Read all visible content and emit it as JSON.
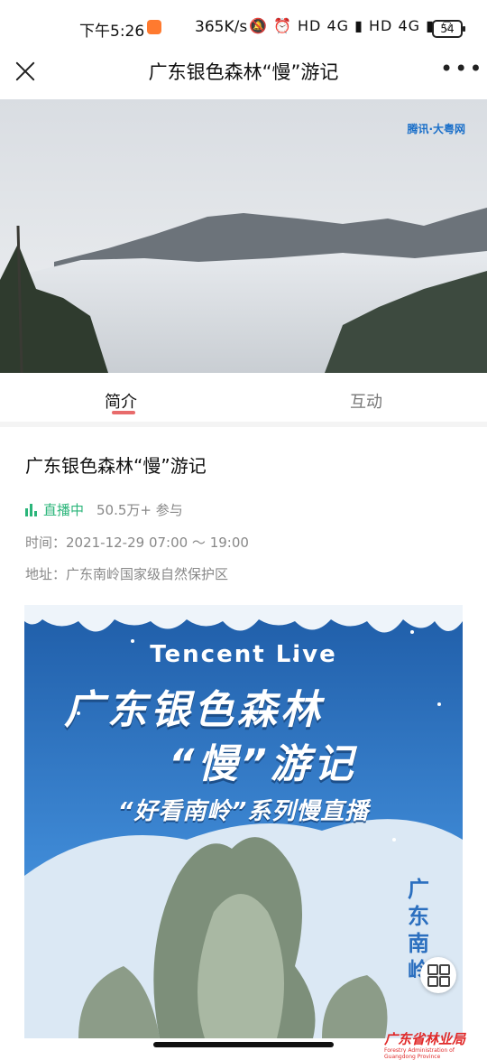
{
  "status_bar": {
    "time": "下午5:26",
    "net_speed": "365K/s",
    "indicators": "🔕 ⏰ HD 4G ▮ HD 4G ▮ ⌔",
    "battery": "54"
  },
  "header": {
    "title": "广东银色森林“慢”游记",
    "more_label": "•••"
  },
  "hero": {
    "logo_text": "腾讯·大粤网"
  },
  "tabs": [
    {
      "label": "简介",
      "active": true
    },
    {
      "label": "互动",
      "active": false
    }
  ],
  "event": {
    "title": "广东银色森林“慢”游记",
    "live_status": "直播中",
    "participants": "50.5万+ 参与",
    "time": "时间：2021-12-29 07:00 ～ 19:00",
    "address": "地址：广东南岭国家级自然保护区"
  },
  "poster": {
    "en_title": "Tencent  Live",
    "title_line1": "广东银色森林",
    "title_line2": "“慢”游记",
    "subtitle": "“好看南岭”系列慢直播",
    "vertical_text": "广东南岭",
    "org_name": "广东省林业局",
    "org_sub": "Forestry Administration of Guangdong Province"
  },
  "colors": {
    "live_green": "#2bb57a",
    "tab_indicator": "#e86b6b",
    "poster_blue": "#2b6fbf",
    "org_red": "#e02a2a"
  }
}
